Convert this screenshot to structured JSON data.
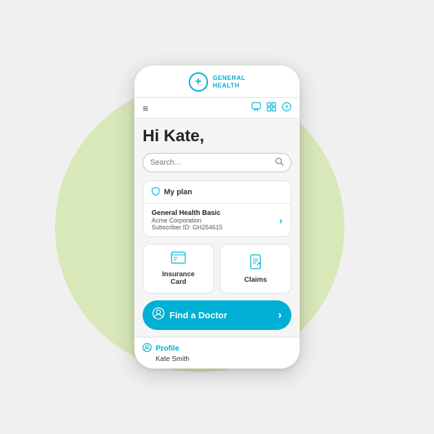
{
  "background": {
    "circle_color": "#d8e8b8"
  },
  "header": {
    "logo_text_line1": "GENERAL",
    "logo_text_line2": "HEALTH",
    "logo_plus": "+"
  },
  "navbar": {
    "hamburger_icon": "≡",
    "icons": [
      "💬",
      "⊞",
      "?"
    ]
  },
  "greeting": "Hi Kate,",
  "search": {
    "placeholder": "Search..."
  },
  "my_plan": {
    "section_title": "My plan",
    "plan_name": "General Health Basic",
    "corporation": "Acme Corporation",
    "subscriber_id": "Subscriber ID: GH254615"
  },
  "quick_actions": [
    {
      "label": "Insurance\nCard",
      "icon": "insurance-card-icon"
    },
    {
      "label": "Claims",
      "icon": "claims-icon"
    }
  ],
  "find_doctor": {
    "label": "Find a Doctor"
  },
  "profile": {
    "link_label": "Profile",
    "name": "Kate Smith"
  }
}
